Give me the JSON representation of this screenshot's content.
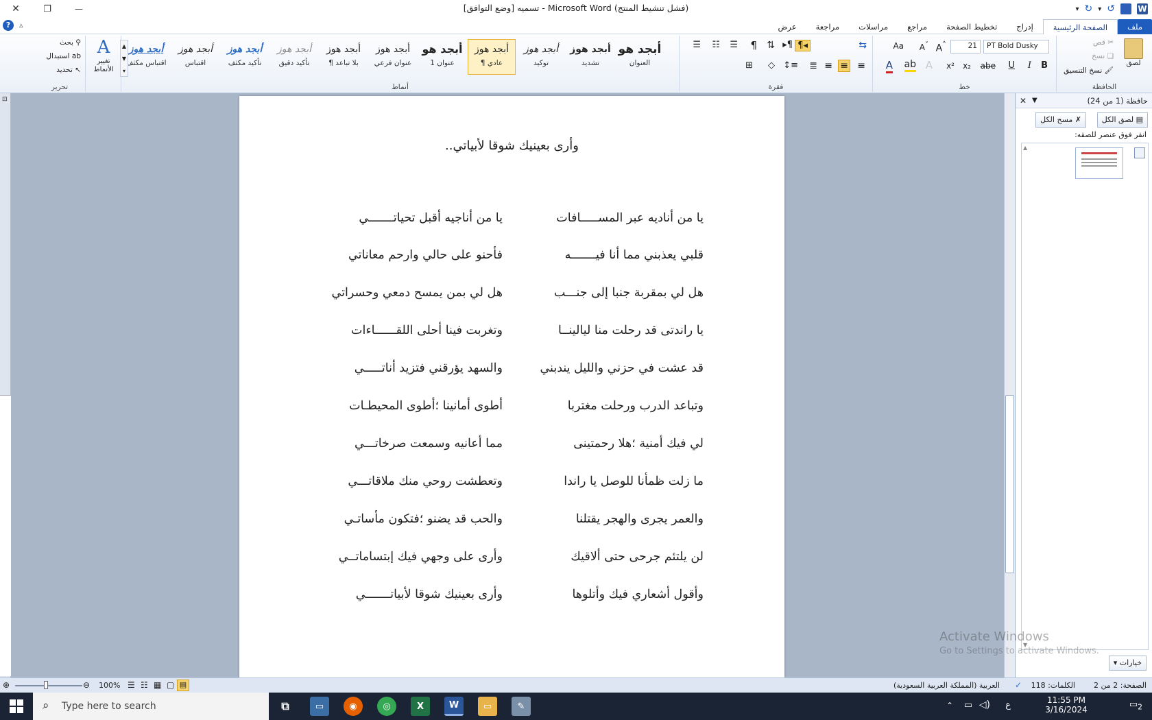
{
  "window": {
    "title": "تسميه [وضع التوافق] - Microsoft Word (فشل تنشيط المنتج)",
    "close_glyph": "✕",
    "restore_glyph": "❐",
    "minimize_glyph": "—"
  },
  "tabs": [
    {
      "label": "ملف"
    },
    {
      "label": "الصفحة الرئيسية"
    },
    {
      "label": "إدراج"
    },
    {
      "label": "تخطيط الصفحة"
    },
    {
      "label": "مراجع"
    },
    {
      "label": "مراسلات"
    },
    {
      "label": "مراجعة"
    },
    {
      "label": "عرض"
    }
  ],
  "ribbon": {
    "clipboard": {
      "group_label": "الحافظة",
      "paste": "لصق",
      "cut": "قص",
      "copy": "نسخ",
      "format_painter": "نسخ التنسيق"
    },
    "font": {
      "group_label": "خط",
      "font_name": "PT Bold Dusky",
      "font_size": "21",
      "bold": "B",
      "italic": "I",
      "underline": "U",
      "strike": "abe",
      "subscript": "x₂",
      "superscript": "x²",
      "grow": "A",
      "shrink": "A",
      "change_case": "Aa"
    },
    "paragraph": {
      "group_label": "فقرة",
      "show_marks": "¶"
    },
    "styles": {
      "group_label": "أنماط",
      "items": [
        {
          "sample": "أبجد هو",
          "name": "العنوان"
        },
        {
          "sample": "أبجد هوز",
          "name": "تشديد"
        },
        {
          "sample": "أبجد هوز",
          "name": "توكيد"
        },
        {
          "sample": "أبجد هوز",
          "name": "¶ عادي"
        },
        {
          "sample": "أبجد هو",
          "name": "عنوان 1"
        },
        {
          "sample": "أبجد هوز",
          "name": "عنوان فرعي"
        },
        {
          "sample": "أبجد هوز",
          "name": "¶ بلا تباعد"
        },
        {
          "sample": "أبجد هوز",
          "name": "تأكيد دقيق"
        },
        {
          "sample": "أبجد هوز",
          "name": "تأكيد مكثف"
        },
        {
          "sample": "أبجد هوز",
          "name": "اقتباس"
        },
        {
          "sample": "أبجد هوز",
          "name": "اقتباس مكثف"
        }
      ],
      "change_styles": "تغيير الأنماط"
    },
    "editing": {
      "group_label": "تحرير",
      "find": "بحث",
      "replace": "استبدال",
      "select": "تحديد"
    }
  },
  "document": {
    "title": "وأرى بعينيك شوقا لأبياتي..",
    "verses": [
      {
        "first": "يا من أناديه عبر المســـــافات",
        "second": "يا من أناجيه أقبل تحياتـــــــي"
      },
      {
        "first": "قلبي يعذبني مما أنا فيـــــــه",
        "second": "فأحنو على حالي وارحم معاناتي"
      },
      {
        "first": "هل لي بمقربة جنبا إلى جنـــب",
        "second": "هل لي بمن يمسح دمعي وحسراتي"
      },
      {
        "first": "يا راندتى قد رحلت منا ليالينــا",
        "second": "وتغربت فينا أحلى اللقــــــاءات"
      },
      {
        "first": "قد عشت في حزني والليل يندبني",
        "second": "والسهد يؤرقني فتزيد أناتـــــي"
      },
      {
        "first": "وتباعد الدرب ورحلت مغتربا",
        "second": "أطوى أمانينا ؛أطوى المحيطـات"
      },
      {
        "first": "لي فيك أمنية ؛هلا رحمتينى",
        "second": "مما أعانيه وسمعت صرخاتـــي"
      },
      {
        "first": "ما زلت ظمأنا للوصل يا راندا",
        "second": "وتعطشت روحي منك ملاقاتـــي"
      },
      {
        "first": "والعمر يجرى والهجر يقتلنا",
        "second": "والحب قد يضنو ؛فتكون مأساتـي"
      },
      {
        "first": "لن يلتئم جرحى حتى ألاقيك",
        "second": "وأرى على وجهي فيك إبتساماتــي"
      },
      {
        "first": "وأقول أشعاري فيك وأتلوها",
        "second": "وأرى بعينيك شوقا لأبياتـــــــي"
      }
    ]
  },
  "clipboard_pane": {
    "title": "حافظة (1 من 24)",
    "paste_all": "لصق الكل",
    "clear_all": "مسح الكل",
    "hint": "انقر فوق عنصر للصقه:",
    "options": "خيارات"
  },
  "watermark": {
    "line1": "Activate Windows",
    "line2": "Go to Settings to activate Windows."
  },
  "status": {
    "page": "الصفحة: 2 من 2",
    "words": "الكلمات: 118",
    "language": "العربية (المملكة العربية السعودية)",
    "zoom": "100%"
  },
  "taskbar": {
    "search_placeholder": "Type here to search",
    "time": "11:55 PM",
    "date": "3/16/2024",
    "lang": "ع",
    "notifications": "2"
  }
}
